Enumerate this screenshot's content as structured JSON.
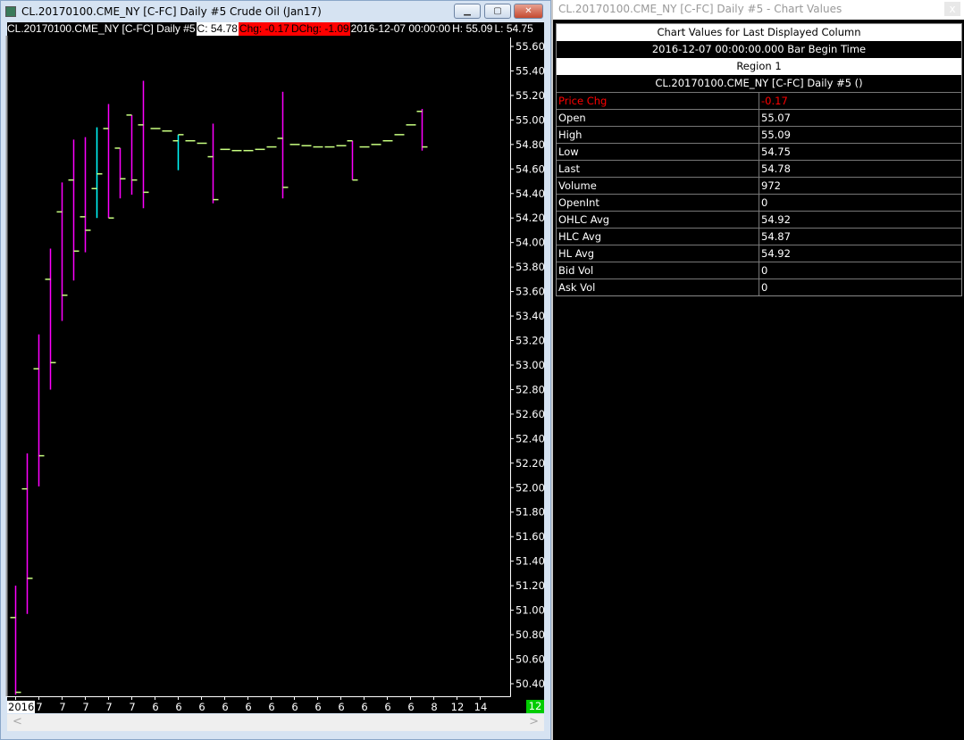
{
  "chart_window": {
    "title": "CL.20170100.CME_NY [C-FC]  Daily  #5  Crude Oil (Jan17)",
    "header": {
      "symbol": "CL.20170100.CME_NY [C-FC]  Daily  #5",
      "close": "C: 54.78",
      "chg": "Chg: -0.17",
      "dchg": "DChg: -1.09",
      "time": "2016-12-07 00:00:00",
      "high": "H: 55.09",
      "low": "L: 54.75"
    },
    "buttons": {
      "minimize": "▁",
      "maximize": "▢",
      "close": "✕"
    },
    "x_labels": [
      {
        "label": "2016",
        "bar": 0
      },
      {
        "label": "7",
        "bar": 2
      },
      {
        "label": "7",
        "bar": 4
      },
      {
        "label": "7",
        "bar": 6
      },
      {
        "label": "7",
        "bar": 8
      },
      {
        "label": "7",
        "bar": 10
      },
      {
        "label": "6",
        "bar": 12
      },
      {
        "label": "6",
        "bar": 14
      },
      {
        "label": "6",
        "bar": 16
      },
      {
        "label": "6",
        "bar": 18
      },
      {
        "label": "6",
        "bar": 20
      },
      {
        "label": "6",
        "bar": 22
      },
      {
        "label": "6",
        "bar": 24
      },
      {
        "label": "6",
        "bar": 26
      },
      {
        "label": "6",
        "bar": 28
      },
      {
        "label": "6",
        "bar": 30
      },
      {
        "label": "6",
        "bar": 32
      },
      {
        "label": "6",
        "bar": 34
      },
      {
        "label": "8",
        "bar": 36
      },
      {
        "label": "12",
        "bar": 38
      },
      {
        "label": "14",
        "bar": 40
      }
    ],
    "x_right_label": "12",
    "scroll": {
      "left": "<",
      "right": ">"
    }
  },
  "chart_data": {
    "type": "ohlc",
    "ylim": [
      50.3,
      55.65
    ],
    "y_ticks": [
      "55.60",
      "55.40",
      "55.20",
      "55.00",
      "54.80",
      "54.60",
      "54.40",
      "54.20",
      "54.00",
      "53.80",
      "53.60",
      "53.40",
      "53.20",
      "53.00",
      "52.80",
      "52.60",
      "52.40",
      "52.20",
      "52.00",
      "51.80",
      "51.60",
      "51.40",
      "51.20",
      "51.00",
      "50.80",
      "50.60",
      "50.40"
    ],
    "colors": {
      "down": "#ff00ff",
      "up": "#00ffff",
      "tick": "#c8ff80"
    },
    "bars": [
      {
        "o": 50.94,
        "h": 51.2,
        "l": 50.31,
        "c": 50.33
      },
      {
        "o": 51.99,
        "h": 52.28,
        "l": 50.97,
        "c": 51.26
      },
      {
        "o": 52.97,
        "h": 53.25,
        "l": 52.01,
        "c": 52.26
      },
      {
        "o": 53.7,
        "h": 53.95,
        "l": 52.8,
        "c": 53.02
      },
      {
        "o": 54.25,
        "h": 54.49,
        "l": 53.36,
        "c": 53.57
      },
      {
        "o": 54.51,
        "h": 54.84,
        "l": 53.69,
        "c": 53.93
      },
      {
        "o": 54.21,
        "h": 54.86,
        "l": 53.92,
        "c": 54.1
      },
      {
        "o": 54.44,
        "h": 54.94,
        "l": 54.2,
        "c": 54.56
      },
      {
        "o": 54.93,
        "h": 55.13,
        "l": 54.2,
        "c": 54.2
      },
      {
        "o": 54.77,
        "h": 54.77,
        "l": 54.36,
        "c": 54.52
      },
      {
        "o": 55.04,
        "h": 55.04,
        "l": 54.39,
        "c": 54.51
      },
      {
        "o": 54.96,
        "h": 55.32,
        "l": 54.28,
        "c": 54.41
      },
      {
        "o": 54.93,
        "h": 54.93,
        "l": 54.93,
        "c": 54.93
      },
      {
        "o": 54.91,
        "h": 54.91,
        "l": 54.91,
        "c": 54.91
      },
      {
        "o": 54.83,
        "h": 54.88,
        "l": 54.59,
        "c": 54.88
      },
      {
        "o": 54.83,
        "h": 54.83,
        "l": 54.83,
        "c": 54.83
      },
      {
        "o": 54.81,
        "h": 54.81,
        "l": 54.81,
        "c": 54.81
      },
      {
        "o": 54.7,
        "h": 54.97,
        "l": 54.32,
        "c": 54.35
      },
      {
        "o": 54.76,
        "h": 54.76,
        "l": 54.76,
        "c": 54.76
      },
      {
        "o": 54.75,
        "h": 54.75,
        "l": 54.75,
        "c": 54.75
      },
      {
        "o": 54.75,
        "h": 54.75,
        "l": 54.75,
        "c": 54.75
      },
      {
        "o": 54.76,
        "h": 54.76,
        "l": 54.76,
        "c": 54.76
      },
      {
        "o": 54.78,
        "h": 54.78,
        "l": 54.78,
        "c": 54.78
      },
      {
        "o": 54.85,
        "h": 55.23,
        "l": 54.36,
        "c": 54.45
      },
      {
        "o": 54.8,
        "h": 54.8,
        "l": 54.8,
        "c": 54.8
      },
      {
        "o": 54.79,
        "h": 54.79,
        "l": 54.79,
        "c": 54.79
      },
      {
        "o": 54.78,
        "h": 54.78,
        "l": 54.78,
        "c": 54.78
      },
      {
        "o": 54.78,
        "h": 54.78,
        "l": 54.78,
        "c": 54.78
      },
      {
        "o": 54.79,
        "h": 54.79,
        "l": 54.79,
        "c": 54.79
      },
      {
        "o": 54.83,
        "h": 54.83,
        "l": 54.51,
        "c": 54.51
      },
      {
        "o": 54.78,
        "h": 54.78,
        "l": 54.78,
        "c": 54.78
      },
      {
        "o": 54.8,
        "h": 54.8,
        "l": 54.8,
        "c": 54.8
      },
      {
        "o": 54.83,
        "h": 54.83,
        "l": 54.83,
        "c": 54.83
      },
      {
        "o": 54.88,
        "h": 54.88,
        "l": 54.88,
        "c": 54.88
      },
      {
        "o": 54.96,
        "h": 54.96,
        "l": 54.96,
        "c": 54.96
      },
      {
        "o": 55.07,
        "h": 55.09,
        "l": 54.75,
        "c": 54.78
      }
    ]
  },
  "chart_values": {
    "title": "CL.20170100.CME_NY [C-FC]  Daily  #5 - Chart Values",
    "close_btn": "x",
    "header": "Chart Values for Last Displayed Column",
    "time": "2016-12-07  00:00:00.000  Bar Begin Time",
    "region": "Region 1",
    "study": "CL.20170100.CME_NY [C-FC]  Daily  #5 ()",
    "rows": [
      {
        "k": "Price Chg",
        "v": "-0.17"
      },
      {
        "k": "Open",
        "v": "55.07"
      },
      {
        "k": "High",
        "v": "55.09"
      },
      {
        "k": "Low",
        "v": "54.75"
      },
      {
        "k": "Last",
        "v": "54.78"
      },
      {
        "k": "Volume",
        "v": "972"
      },
      {
        "k": "OpenInt",
        "v": "0"
      },
      {
        "k": "OHLC Avg",
        "v": "54.92"
      },
      {
        "k": "HLC Avg",
        "v": "54.87"
      },
      {
        "k": "HL Avg",
        "v": "54.92"
      },
      {
        "k": "Bid Vol",
        "v": "0"
      },
      {
        "k": "Ask Vol",
        "v": "0"
      }
    ]
  }
}
